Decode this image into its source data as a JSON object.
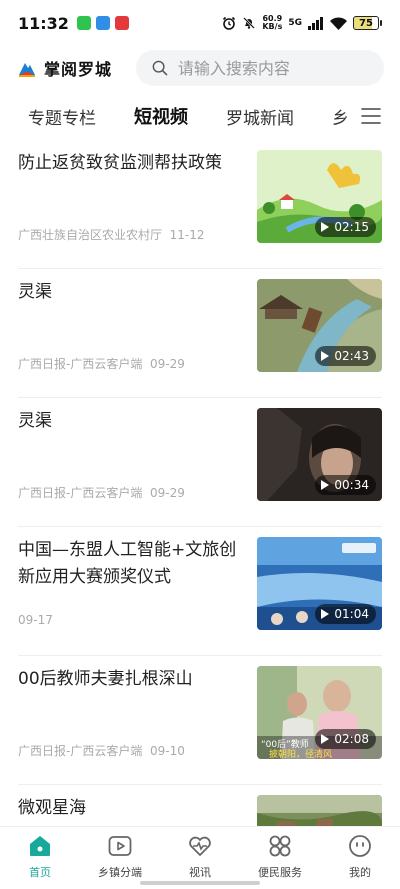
{
  "status_bar": {
    "time": "11:32",
    "net_speed": "60.9",
    "net_speed_unit": "KB/s",
    "network": "5G",
    "battery": "75",
    "apps": [
      {
        "name": "wechat-icon",
        "color": "#2ec44f"
      },
      {
        "name": "message-icon",
        "color": "#2f8fe6"
      },
      {
        "name": "news-icon",
        "color": "#e4393c"
      }
    ]
  },
  "header": {
    "logo_text": "掌阅罗城",
    "search_placeholder": "请输入搜索内容"
  },
  "tabs": [
    "专题专栏",
    "短视频",
    "罗城新闻",
    "乡"
  ],
  "active_tab": 1,
  "feed": [
    {
      "title": "防止返贫致贫监测帮扶政策",
      "source": "广西壮族自治区农业农村厅",
      "date": "11-12",
      "duration": "02:15",
      "thumb": "landscape-cartoon"
    },
    {
      "title": "灵渠",
      "source": "广西日报-广西云客户端",
      "date": "09-29",
      "duration": "02:43",
      "thumb": "canal-model"
    },
    {
      "title": "灵渠",
      "source": "广西日报-广西云客户端",
      "date": "09-29",
      "duration": "00:34",
      "thumb": "dark-portrait"
    },
    {
      "title": "中国—东盟人工智能+文旅创新应用大赛颁奖仪式",
      "source": "",
      "date": "09-17",
      "duration": "01:04",
      "thumb": "stage-event"
    },
    {
      "title": "00后教师夫妻扎根深山",
      "source": "广西日报-广西云客户端",
      "date": "09-10",
      "duration": "02:08",
      "thumb": "teachers",
      "overlay_lines": [
        "“00后”教师",
        "披朝阳，径清风"
      ]
    },
    {
      "title": "微观星海",
      "source": "",
      "date": "",
      "duration": "",
      "thumb": "village"
    }
  ],
  "bottom_nav": [
    {
      "label": "首页",
      "icon": "home-icon",
      "active": true
    },
    {
      "label": "乡镇分端",
      "icon": "play-square-icon",
      "active": false
    },
    {
      "label": "视讯",
      "icon": "heart-pulse-icon",
      "active": false
    },
    {
      "label": "便民服务",
      "icon": "grid-icon",
      "active": false
    },
    {
      "label": "我的",
      "icon": "smile-icon",
      "active": false
    }
  ],
  "colors": {
    "accent": "#19a99a",
    "text": "#222222",
    "meta": "#aaaaaa"
  }
}
